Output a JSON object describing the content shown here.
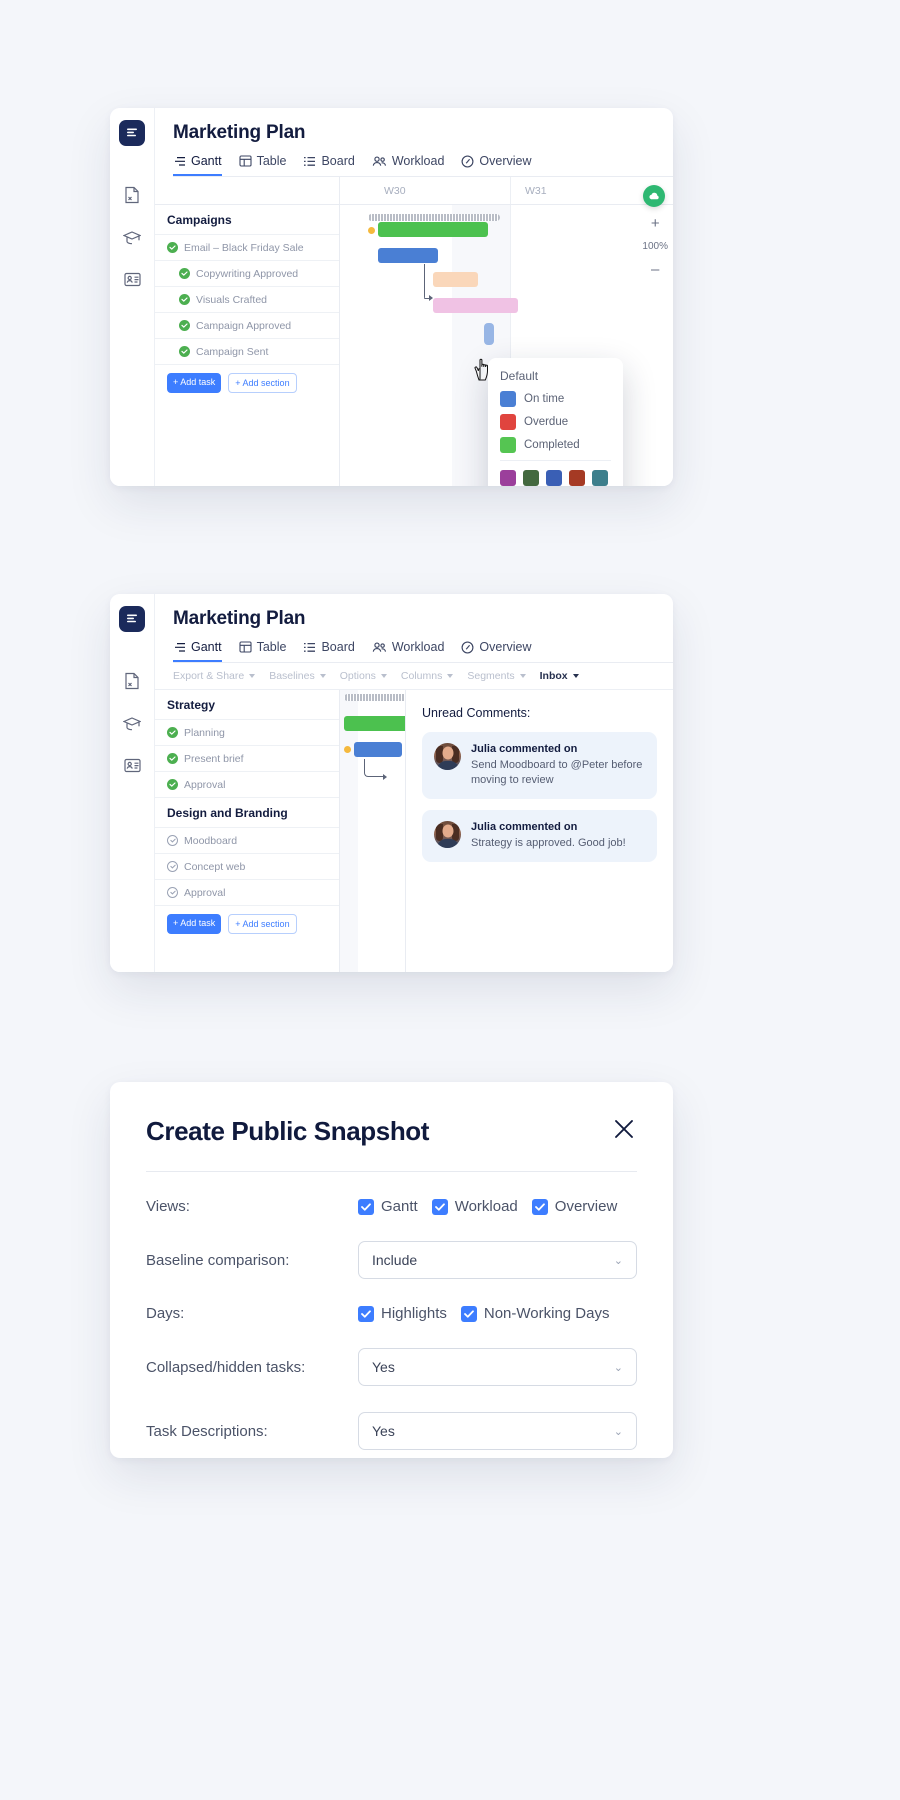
{
  "app": {
    "title": "Marketing Plan",
    "tabs": [
      {
        "label": "Gantt",
        "icon": "gantt-icon",
        "active": true
      },
      {
        "label": "Table",
        "icon": "table-icon",
        "active": false
      },
      {
        "label": "Board",
        "icon": "board-icon",
        "active": false
      },
      {
        "label": "Workload",
        "icon": "people-icon",
        "active": false
      },
      {
        "label": "Overview",
        "icon": "gauge-icon",
        "active": false
      }
    ],
    "rail_icons": [
      "logo-icon",
      "document-icon",
      "graduation-cap-icon",
      "contact-card-icon"
    ]
  },
  "card1": {
    "timeline_weeks": [
      "W30",
      "W31"
    ],
    "section_title": "Campaigns",
    "tasks": [
      {
        "label": "Email – Black Friday Sale",
        "state": "done",
        "indent": 1
      },
      {
        "label": "Copywriting Approved",
        "state": "done",
        "indent": 2
      },
      {
        "label": "Visuals Crafted",
        "state": "done",
        "indent": 2
      },
      {
        "label": "Campaign Approved",
        "state": "done",
        "indent": 2
      },
      {
        "label": "Campaign Sent",
        "state": "done",
        "indent": 2
      }
    ],
    "add_task_label": "+ Add task",
    "add_section_label": "+ Add section",
    "zoom_level": "100%",
    "zoom_in_label": "+",
    "zoom_out_label": "–",
    "color_popup": {
      "title": "Default",
      "statuses": [
        {
          "label": "On time",
          "color": "#4a7fd4"
        },
        {
          "label": "Overdue",
          "color": "#e0443e"
        },
        {
          "label": "Completed",
          "color": "#55c552"
        }
      ],
      "palette": [
        "#9b3f9b",
        "#43693f",
        "#3a5fb5",
        "#a53a24",
        "#3d7f8c",
        "#6b4c3d",
        "#d1791d",
        "#5c3ad6",
        "#2d2f36",
        "#b5c08a",
        "#9fb4cc",
        "#e8a8a3",
        "#a8cbe8",
        "#efcf9a",
        "#b5b5bd"
      ]
    }
  },
  "card2": {
    "toolbar": [
      {
        "label": "Export & Share",
        "strong": false
      },
      {
        "label": "Baselines",
        "strong": false
      },
      {
        "label": "Options",
        "strong": false
      },
      {
        "label": "Columns",
        "strong": false
      },
      {
        "label": "Segments",
        "strong": false
      },
      {
        "label": "Inbox",
        "strong": true
      }
    ],
    "sections": [
      {
        "title": "Strategy",
        "tasks": [
          {
            "label": "Planning",
            "state": "done"
          },
          {
            "label": "Present brief",
            "state": "done"
          },
          {
            "label": "Approval",
            "state": "done"
          }
        ]
      },
      {
        "title": "Design and Branding",
        "tasks": [
          {
            "label": "Moodboard",
            "state": "open"
          },
          {
            "label": "Concept web",
            "state": "open"
          },
          {
            "label": "Approval",
            "state": "open"
          }
        ]
      }
    ],
    "add_task_label": "+ Add task",
    "add_section_label": "+ Add section",
    "comments": {
      "heading": "Unread Comments:",
      "items": [
        {
          "who": "Julia commented on",
          "text": "Send Moodboard to @Peter before moving to review"
        },
        {
          "who": "Julia commented on",
          "text": "Strategy is approved. Good job!"
        }
      ]
    }
  },
  "modal": {
    "title": "Create Public Snapshot",
    "close_icon": "close-icon",
    "rows": [
      {
        "label": "Views:",
        "type": "checkboxes",
        "options": [
          {
            "label": "Gantt",
            "checked": true
          },
          {
            "label": "Workload",
            "checked": true
          },
          {
            "label": "Overview",
            "checked": true
          }
        ]
      },
      {
        "label": "Baseline comparison:",
        "type": "select",
        "value": "Include"
      },
      {
        "label": "Days:",
        "type": "checkboxes",
        "options": [
          {
            "label": "Highlights",
            "checked": true
          },
          {
            "label": "Non-Working Days",
            "checked": true
          }
        ]
      },
      {
        "label": "Collapsed/hidden tasks:",
        "type": "select",
        "value": "Yes"
      },
      {
        "label": "Task Descriptions:",
        "type": "select",
        "value": "Yes"
      }
    ]
  },
  "colors": {
    "accent": "#3d7dff",
    "brand_navy": "#1b2a5b",
    "page_bg": "#f4f6fa",
    "green": "#4cc14f",
    "red": "#e0443e",
    "blue_bar": "#4a7fd4"
  }
}
